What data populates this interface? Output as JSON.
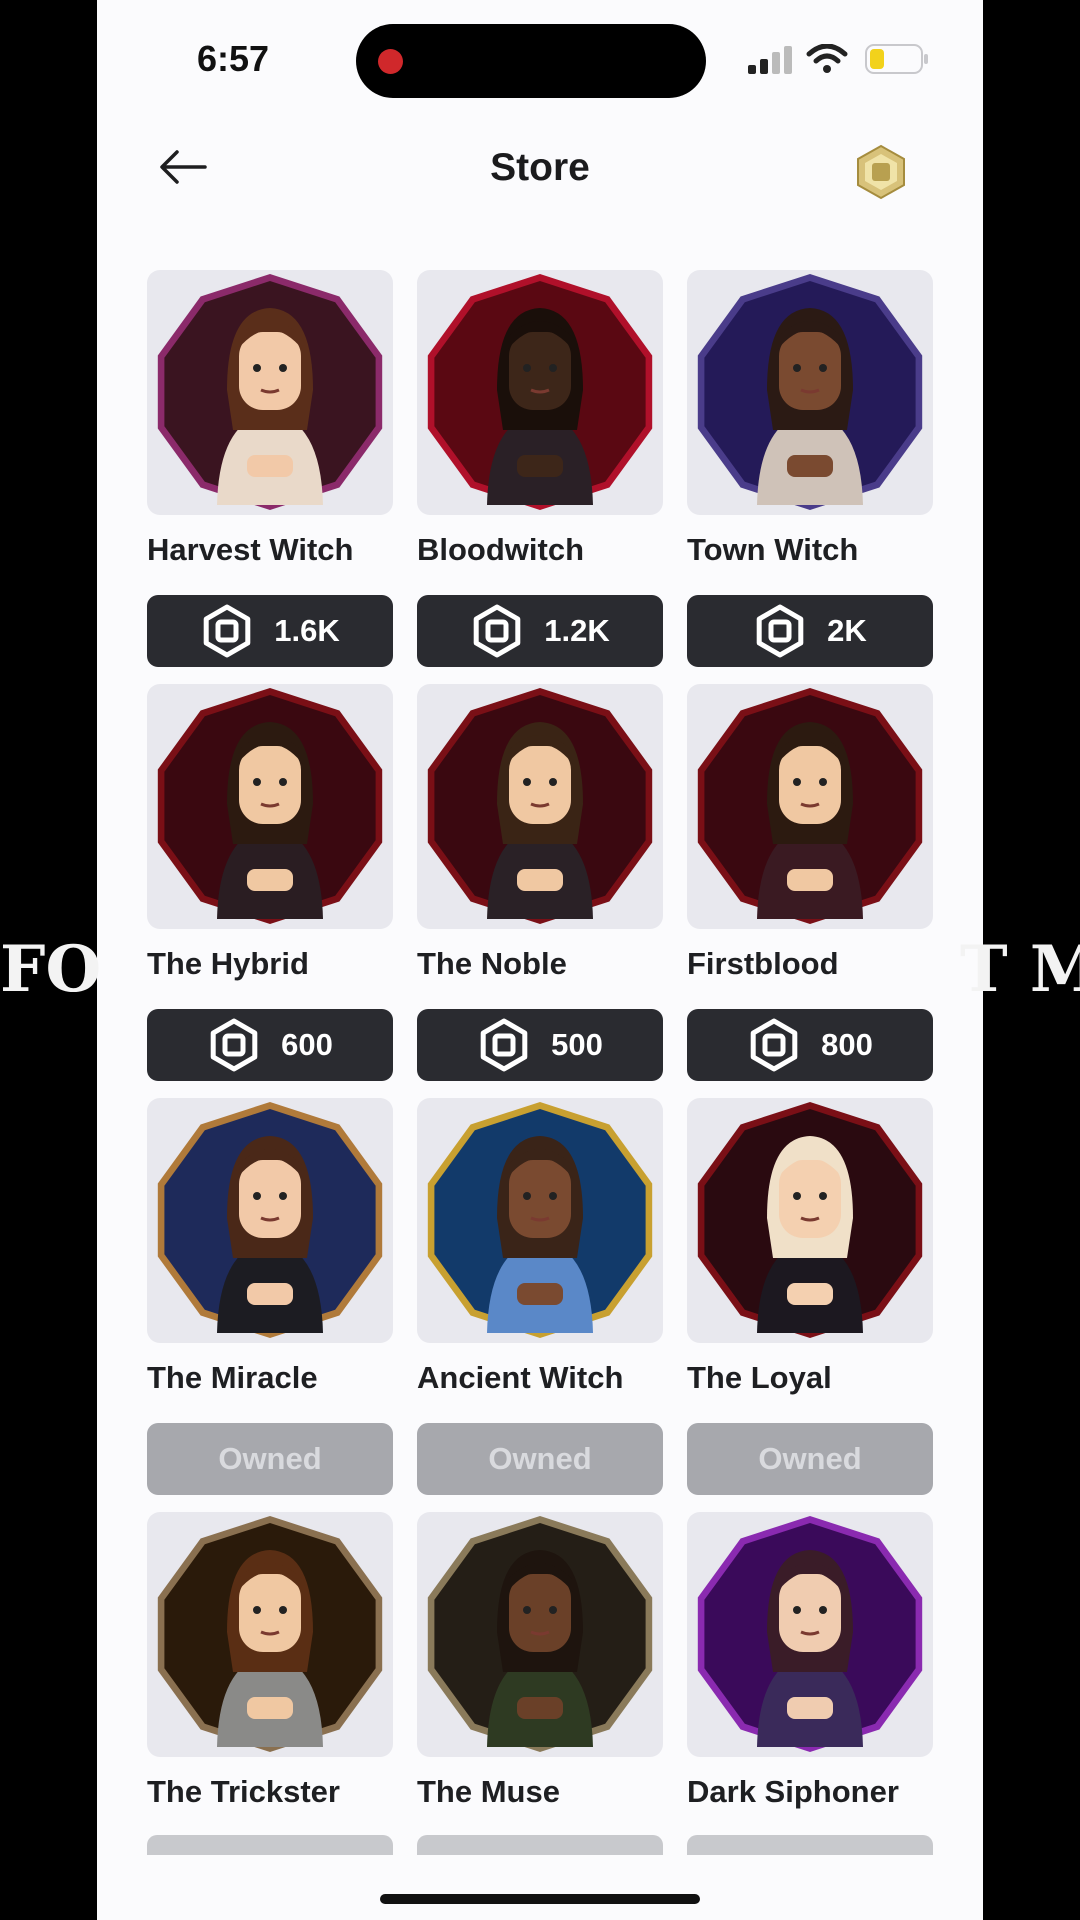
{
  "status_bar": {
    "time": "6:57"
  },
  "header": {
    "title": "Store"
  },
  "colors": {
    "background": "#fbfbfd",
    "button_dark": "#2a2b30",
    "button_owned": "#a7a8ad",
    "robux_gold": "#c9b25a"
  },
  "items": [
    {
      "name": "Harvest Witch",
      "price": "1.6K",
      "owned": false,
      "frame": "#8b2a6a",
      "bg": "#3a1420",
      "skin": "#f2c9a8",
      "hair": "#5a2e1a",
      "outfit": "#e9d9c9"
    },
    {
      "name": "Bloodwitch",
      "price": "1.2K",
      "owned": false,
      "frame": "#b0102a",
      "bg": "#5a0812",
      "skin": "#3d2619",
      "hair": "#1a0f0a",
      "outfit": "#2a2026"
    },
    {
      "name": "Town Witch",
      "price": "2K",
      "owned": false,
      "frame": "#4a3c8a",
      "bg": "#241a58",
      "skin": "#7a4a30",
      "hair": "#2b1a14",
      "outfit": "#cfc2b8"
    },
    {
      "name": "The Hybrid",
      "price": "600",
      "owned": false,
      "frame": "#7a0f16",
      "bg": "#3a0810",
      "skin": "#f0c8a2",
      "hair": "#2c1a10",
      "outfit": "#2a1d22"
    },
    {
      "name": "The Noble",
      "price": "500",
      "owned": false,
      "frame": "#7a0f16",
      "bg": "#3a0810",
      "skin": "#f0c8a2",
      "hair": "#3a2415",
      "outfit": "#2a2126"
    },
    {
      "name": "Firstblood",
      "price": "800",
      "owned": false,
      "frame": "#7a0f16",
      "bg": "#3a0810",
      "skin": "#f0c8a2",
      "hair": "#2c1a10",
      "outfit": "#3a1a22"
    },
    {
      "name": "The Miracle",
      "price": "Owned",
      "owned": true,
      "frame": "#b07a3a",
      "bg": "#1e2a5a",
      "skin": "#f2c9a8",
      "hair": "#4a2818",
      "outfit": "#1c1c22"
    },
    {
      "name": "Ancient Witch",
      "price": "Owned",
      "owned": true,
      "frame": "#c8a030",
      "bg": "#123a6a",
      "skin": "#7a4a30",
      "hair": "#3a2418",
      "outfit": "#5a88c8"
    },
    {
      "name": "The Loyal",
      "price": "Owned",
      "owned": true,
      "frame": "#7a0f16",
      "bg": "#2a0a10",
      "skin": "#f4d0b0",
      "hair": "#f0e0c8",
      "outfit": "#1c1820"
    },
    {
      "name": "The Trickster",
      "price": "",
      "owned": false,
      "frame": "#8a7050",
      "bg": "#2a1a0a",
      "skin": "#f0c8a2",
      "hair": "#5a2e14",
      "outfit": "#8a8a88"
    },
    {
      "name": "The Muse",
      "price": "",
      "owned": false,
      "frame": "#8a7a5a",
      "bg": "#241e16",
      "skin": "#6a4028",
      "hair": "#1e140e",
      "outfit": "#2e3a22"
    },
    {
      "name": "Dark Siphoner",
      "price": "",
      "owned": false,
      "frame": "#8a2ab0",
      "bg": "#3a0a5a",
      "skin": "#f0ccb0",
      "hair": "#3a1c28",
      "outfit": "#3a2a5a"
    }
  ]
}
